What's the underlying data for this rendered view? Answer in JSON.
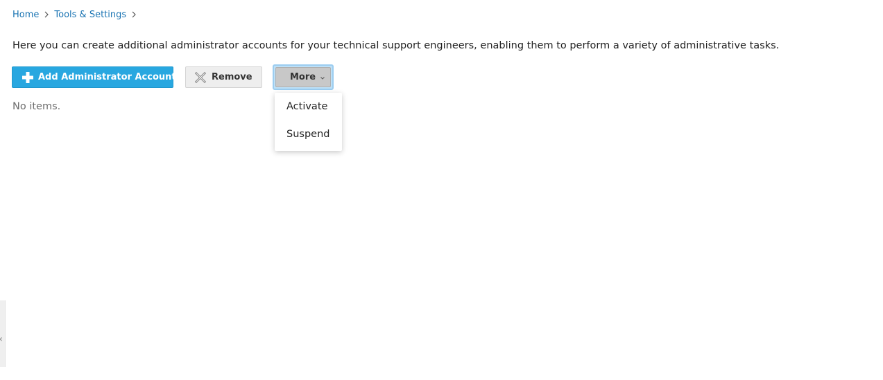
{
  "breadcrumb": {
    "items": [
      {
        "label": "Home"
      },
      {
        "label": "Tools & Settings"
      }
    ],
    "separator_icon": "chevron-right-icon"
  },
  "description": "Here you can create additional administrator accounts for your technical support engineers, enabling them to perform a variety of administrative tasks.",
  "toolbar": {
    "add_label": "Add Administrator Account",
    "add_icon": "plus-icon",
    "remove_label": "Remove",
    "remove_icon": "close-icon",
    "more_label": "More",
    "more_icon": "chevron-down-icon"
  },
  "list": {
    "empty_text": "No items."
  },
  "more_menu": {
    "items": [
      {
        "label": "Activate"
      },
      {
        "label": "Suspend"
      }
    ]
  },
  "colors": {
    "link": "#1a74b3",
    "primary_button": "#28a7e0",
    "secondary_button": "#eeeeee",
    "active_button": "#c8c8c8",
    "focus_ring": "#bde0f7"
  }
}
